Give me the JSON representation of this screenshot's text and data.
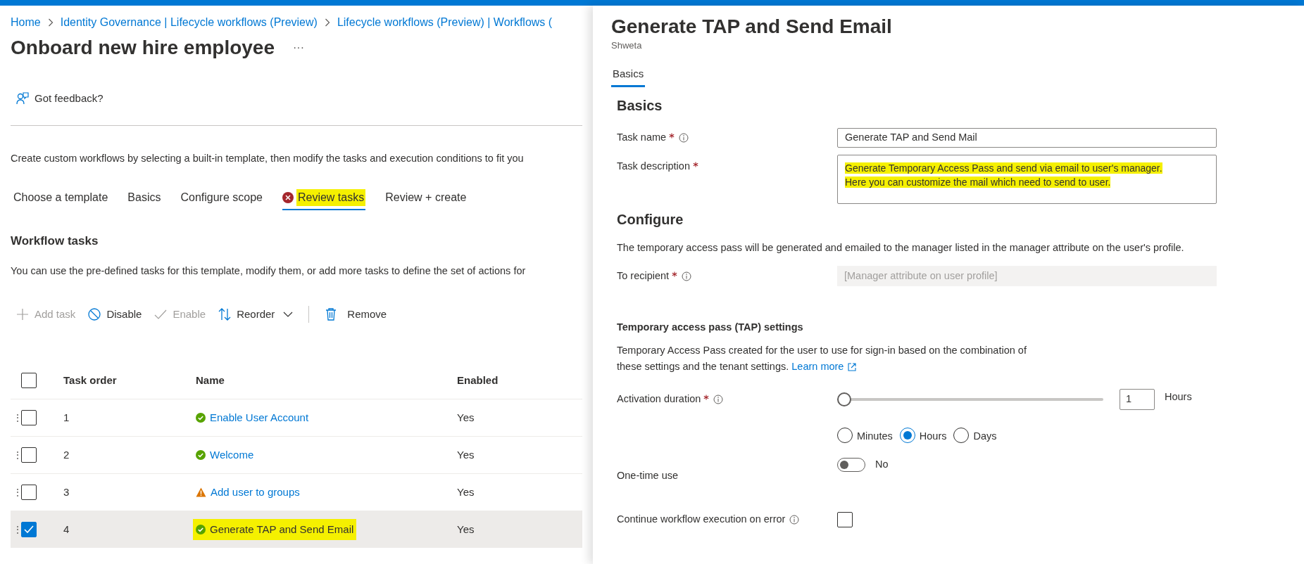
{
  "breadcrumb": [
    {
      "label": "Home"
    },
    {
      "label": "Identity Governance | Lifecycle workflows (Preview)"
    },
    {
      "label": "Lifecycle workflows (Preview) | Workflows ("
    }
  ],
  "page": {
    "title": "Onboard new hire employee",
    "more": "···"
  },
  "feedback": "Got feedback?",
  "description": "Create custom workflows by selecting a built-in template, then modify the tasks and execution conditions to fit you",
  "wizard_tabs": [
    {
      "label": "Choose a template",
      "selected": false,
      "error": false,
      "highlighted": false
    },
    {
      "label": "Basics",
      "selected": false,
      "error": false,
      "highlighted": false
    },
    {
      "label": "Configure scope",
      "selected": false,
      "error": false,
      "highlighted": false
    },
    {
      "label": "Review tasks",
      "selected": true,
      "error": true,
      "highlighted": true
    },
    {
      "label": "Review + create",
      "selected": false,
      "error": false,
      "highlighted": false
    }
  ],
  "section_title": "Workflow tasks",
  "section_text": "You can use the pre-defined tasks for this template, modify them, or add more tasks to define the set of actions for",
  "toolbar": [
    {
      "kind": "add",
      "label": "Add task",
      "disabled": true
    },
    {
      "kind": "disable",
      "label": "Disable",
      "disabled": false
    },
    {
      "kind": "enable",
      "label": "Enable",
      "disabled": true
    },
    {
      "kind": "reorder",
      "label": "Reorder",
      "disabled": false
    },
    {
      "kind": "remove",
      "label": "Remove",
      "disabled": false
    }
  ],
  "table": {
    "columns": [
      "Task order",
      "Name",
      "Enabled"
    ],
    "all_checked": false,
    "rows": [
      {
        "handle": "⋮",
        "order": "1",
        "name": "Enable User Account",
        "kind": "ok",
        "enabled": "Yes",
        "checked": false,
        "highlighted": false
      },
      {
        "handle": "⋮",
        "order": "2",
        "name": "Welcome",
        "kind": "ok",
        "enabled": "Yes",
        "checked": false,
        "highlighted": false
      },
      {
        "handle": "⋮",
        "order": "3",
        "name": "Add user to groups",
        "kind": "warning",
        "enabled": "Yes",
        "checked": false,
        "highlighted": false
      },
      {
        "handle": "⋮",
        "order": "4",
        "name": "Generate TAP and Send Email",
        "kind": "ok",
        "enabled": "Yes",
        "checked": true,
        "highlighted": true
      }
    ]
  },
  "panel": {
    "title": "Generate TAP and Send Email",
    "subtitle": "Shweta",
    "tabs": [
      {
        "label": "Basics",
        "selected": true
      }
    ],
    "basics_heading": "Basics",
    "fields": [
      {
        "kind": "text",
        "label": "Task name",
        "required": true,
        "info": true,
        "value": "Generate TAP and Send Mail",
        "highlighted": false
      },
      {
        "kind": "textarea",
        "label": "Task description",
        "required": true,
        "info": false,
        "value": "Generate Temporary Access Pass and send via email to user's manager.\nHere you can customize the mail which need to send to user.",
        "highlighted": true
      }
    ],
    "configure_heading": "Configure",
    "configure_text": "The temporary access pass will be generated and emailed to the manager listed in the manager attribute on the user's profile.",
    "recipient": {
      "label": "To recipient",
      "required": true,
      "info": true,
      "disabled": true,
      "value": "[Manager attribute on user profile]"
    },
    "tap": {
      "heading": "Temporary access pass (TAP) settings",
      "text": "Temporary Access Pass created for the user to use for sign-in based on the combination of these settings and the tenant settings.",
      "link": "Learn more",
      "duration": {
        "label": "Activation duration",
        "required": true,
        "info": true,
        "level": 0,
        "value": "1",
        "unit": "Hours"
      },
      "units": [
        {
          "label": "Minutes",
          "selected": false
        },
        {
          "label": "Hours",
          "selected": true
        },
        {
          "label": "Days",
          "selected": false
        }
      ],
      "one_time": {
        "label": "One-time use",
        "on": false,
        "state_label": "No"
      }
    },
    "continue_on_error": {
      "label": "Continue workflow execution on error",
      "info": true,
      "checked": false
    }
  }
}
